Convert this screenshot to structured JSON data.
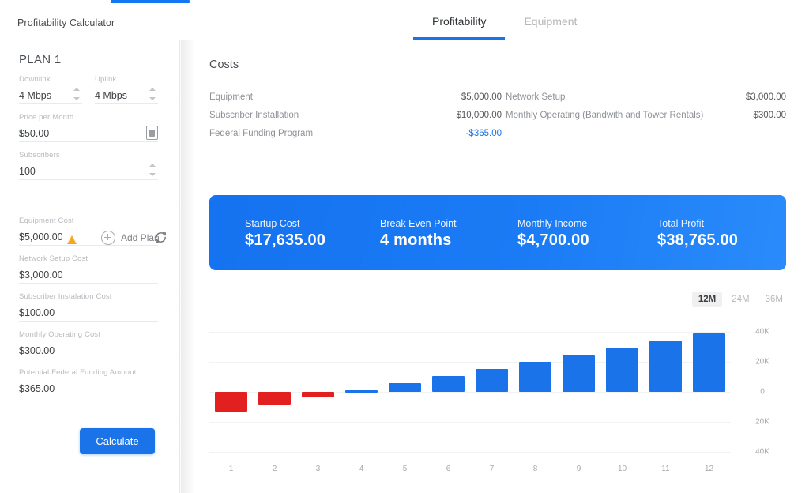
{
  "header": {
    "brand": "Profitability Calculator",
    "tabs": [
      {
        "label": "Profitability",
        "active": true
      },
      {
        "label": "Equipment",
        "active": false
      }
    ]
  },
  "sidebar": {
    "plan_title": "PLAN 1",
    "fields": [
      {
        "label": "Downlink",
        "value": "4 Mbps",
        "control": "stepper"
      },
      {
        "label": "Uplink",
        "value": "4 Mbps",
        "control": "stepper"
      },
      {
        "label": "Price per Month",
        "value": "$50.00",
        "control": "box-icon"
      },
      {
        "label": "Subscribers",
        "value": "100",
        "control": "stepper"
      },
      {
        "label": "Equipment Cost",
        "value": "$5,000.00",
        "control": "refresh",
        "warning": true
      },
      {
        "label": "Network Setup Cost",
        "value": "$3,000.00",
        "control": "none"
      },
      {
        "label": "Subscriber Instalation Cost",
        "value": "$100.00",
        "control": "none"
      },
      {
        "label": "Monthly Operating Cost",
        "value": "$300.00",
        "control": "none"
      },
      {
        "label": "Potential Federal Funding Amount",
        "value": "$365.00",
        "control": "none"
      }
    ],
    "add_plan_label": "Add Plan",
    "calculate_label": "Calculate"
  },
  "main": {
    "costs_title": "Costs",
    "costs_left": [
      {
        "label": "Equipment",
        "amount": "$5,000.00",
        "negative": false
      },
      {
        "label": "Subscriber Installation",
        "amount": "$10,000.00",
        "negative": false
      },
      {
        "label": "Federal Funding Program",
        "amount": "-$365.00",
        "negative": true
      }
    ],
    "costs_right": [
      {
        "label": "Network Setup",
        "amount": "$3,000.00",
        "negative": false
      },
      {
        "label": "Monthly Operating (Bandwith and Tower Rentals)",
        "amount": "$300.00",
        "negative": false
      }
    ],
    "summary": [
      {
        "key": "Startup Cost",
        "value": "$17,635.00"
      },
      {
        "key": "Break Even Point",
        "value": "4 months"
      },
      {
        "key": "Monthly Income",
        "value": "$4,700.00"
      },
      {
        "key": "Total Profit",
        "value": "$38,765.00"
      }
    ],
    "periods": [
      {
        "label": "12M",
        "active": true
      },
      {
        "label": "24M",
        "active": false
      },
      {
        "label": "36M",
        "active": false
      }
    ]
  },
  "colors": {
    "accent": "#1a73e8",
    "bar_positive": "#1a73e8",
    "bar_negative": "#e32020",
    "warning": "#f5a623",
    "banner_start": "#1572f0",
    "banner_end": "#2a8bfb"
  },
  "chart_data": {
    "type": "bar",
    "title": "",
    "xlabel": "",
    "ylabel": "",
    "categories": [
      "1",
      "2",
      "3",
      "4",
      "5",
      "6",
      "7",
      "8",
      "9",
      "10",
      "11",
      "12"
    ],
    "values": [
      -12935,
      -8235,
      -3535,
      1165,
      5865,
      10565,
      15265,
      19965,
      24665,
      29365,
      34065,
      38765
    ],
    "ytick_labels": [
      "40K",
      "20K",
      "0",
      "20K",
      "40K"
    ],
    "yticks": [
      40000,
      20000,
      0,
      -20000,
      -40000
    ],
    "ylim": [
      -45000,
      45000
    ],
    "grid": true,
    "legend": "none",
    "series_colors": {
      "positive": "#1a73e8",
      "negative": "#e32020"
    }
  }
}
